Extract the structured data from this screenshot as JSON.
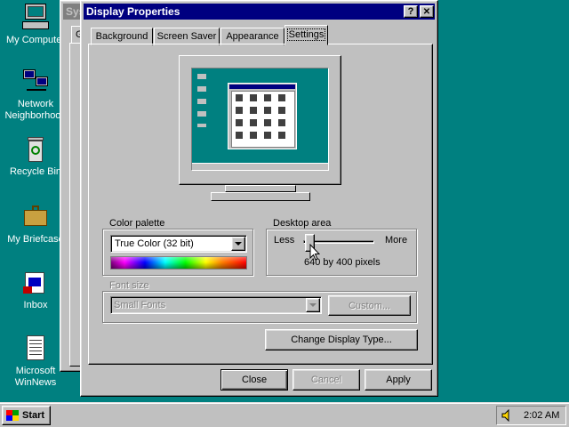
{
  "desktop": {
    "icons": [
      {
        "label": "My Computer"
      },
      {
        "label": "Network Neighborhood"
      },
      {
        "label": "Recycle Bin"
      },
      {
        "label": "My Briefcase"
      },
      {
        "label": "Inbox"
      },
      {
        "label": "Microsoft WinNews"
      }
    ]
  },
  "background_window": {
    "title_partial": "Sys",
    "tab_partial": "G"
  },
  "dialog": {
    "title": "Display Properties",
    "help_glyph": "?",
    "close_glyph": "✕",
    "tabs": [
      {
        "label": "Background"
      },
      {
        "label": "Screen Saver"
      },
      {
        "label": "Appearance"
      },
      {
        "label": "Settings"
      }
    ],
    "active_tab": "Settings",
    "color_palette": {
      "group_label": "Color palette",
      "selected": "True Color (32 bit)"
    },
    "desktop_area": {
      "group_label": "Desktop area",
      "less_label": "Less",
      "more_label": "More",
      "resolution_text": "640 by 400 pixels",
      "slider_level": 0.0
    },
    "font_size": {
      "group_label": "Font size",
      "selected": "Small Fonts",
      "custom_label": "Custom..."
    },
    "change_display_type_label": "Change Display Type...",
    "close_label": "Close",
    "cancel_label": "Cancel",
    "apply_label": "Apply"
  },
  "taskbar": {
    "start_label": "Start",
    "clock": "2:02 AM"
  },
  "colors": {
    "desktop": "#008080",
    "titlebar_active": "#000080",
    "titlebar_inactive": "#808080",
    "face": "#c0c0c0"
  }
}
